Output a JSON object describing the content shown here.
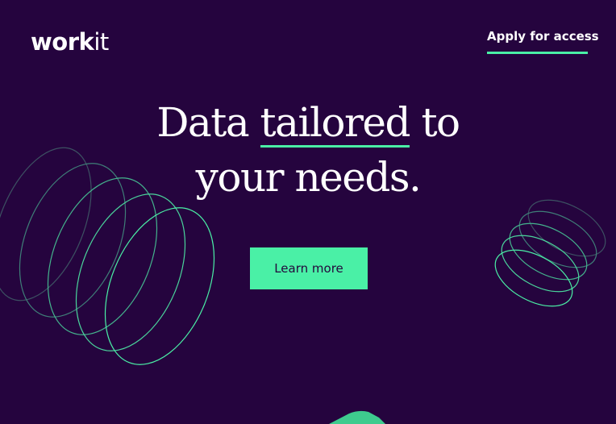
{
  "brand": {
    "logo_bold": "work",
    "logo_light": "it"
  },
  "nav": {
    "apply_label": "Apply for access"
  },
  "hero": {
    "headline_part1": "Data ",
    "headline_underlined": "tailored",
    "headline_part2": " to",
    "headline_line2": "your needs.",
    "cta_label": "Learn more"
  },
  "colors": {
    "background": "#25043e",
    "accent": "#4af0a6",
    "text": "#ffffff",
    "cta_text": "#24073c"
  }
}
